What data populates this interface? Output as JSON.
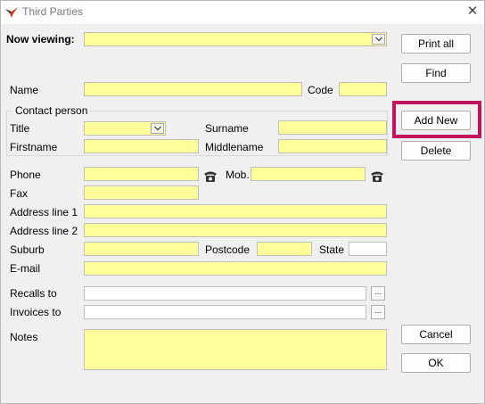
{
  "window": {
    "title": "Third Parties",
    "close_glyph": "✕"
  },
  "labels": {
    "now_viewing": "Now viewing:",
    "name": "Name",
    "code": "Code",
    "contact_person": "Contact person",
    "title": "Title",
    "surname": "Surname",
    "firstname": "Firstname",
    "middlename": "Middlename",
    "phone": "Phone",
    "mob": "Mob.",
    "fax": "Fax",
    "address1": "Address line 1",
    "address2": "Address line 2",
    "suburb": "Suburb",
    "postcode": "Postcode",
    "state": "State",
    "email": "E-mail",
    "recalls_to": "Recalls to",
    "invoices_to": "Invoices to",
    "notes": "Notes"
  },
  "fields": {
    "now_viewing": "",
    "name": "",
    "code": "",
    "title": "",
    "surname": "",
    "firstname": "",
    "middlename": "",
    "phone": "",
    "mob": "",
    "fax": "",
    "address1": "",
    "address2": "",
    "suburb": "",
    "postcode": "",
    "state": "",
    "email": "",
    "recalls_to": "",
    "invoices_to": "",
    "notes": ""
  },
  "buttons": {
    "print_all": "Print all",
    "find": "Find",
    "add_new": "Add New",
    "delete": "Delete",
    "cancel": "Cancel",
    "ok": "OK",
    "browse": "..."
  },
  "icons": {
    "app": "app-logo-icon",
    "close": "close-icon",
    "dropdown": "chevron-down-icon",
    "phone": "telephone-icon"
  },
  "colors": {
    "field_yellow": "#ffff99",
    "highlight": "#c0155d",
    "window_bg": "#f0f0f0"
  }
}
